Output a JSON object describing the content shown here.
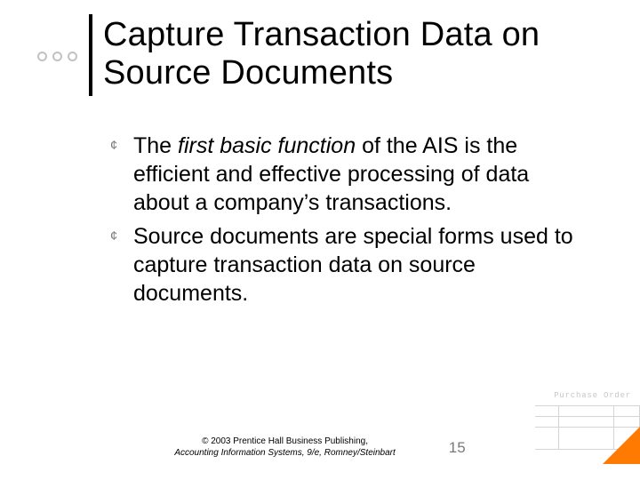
{
  "title": "Capture Transaction Data on Source Documents",
  "bullets": [
    {
      "pre": "The ",
      "emph": "first basic function",
      "post": " of the AIS is the efficient and effective processing of data about a company’s transactions."
    },
    {
      "pre": "",
      "emph": "",
      "post": "Source documents are special forms used to capture transaction data on source documents."
    }
  ],
  "footer": {
    "line1": "© 2003 Prentice Hall Business Publishing,",
    "line2": "Accounting Information Systems, 9/e, Romney/Steinbart"
  },
  "page_number": "15",
  "purchase_order_label": "Purchase Order"
}
